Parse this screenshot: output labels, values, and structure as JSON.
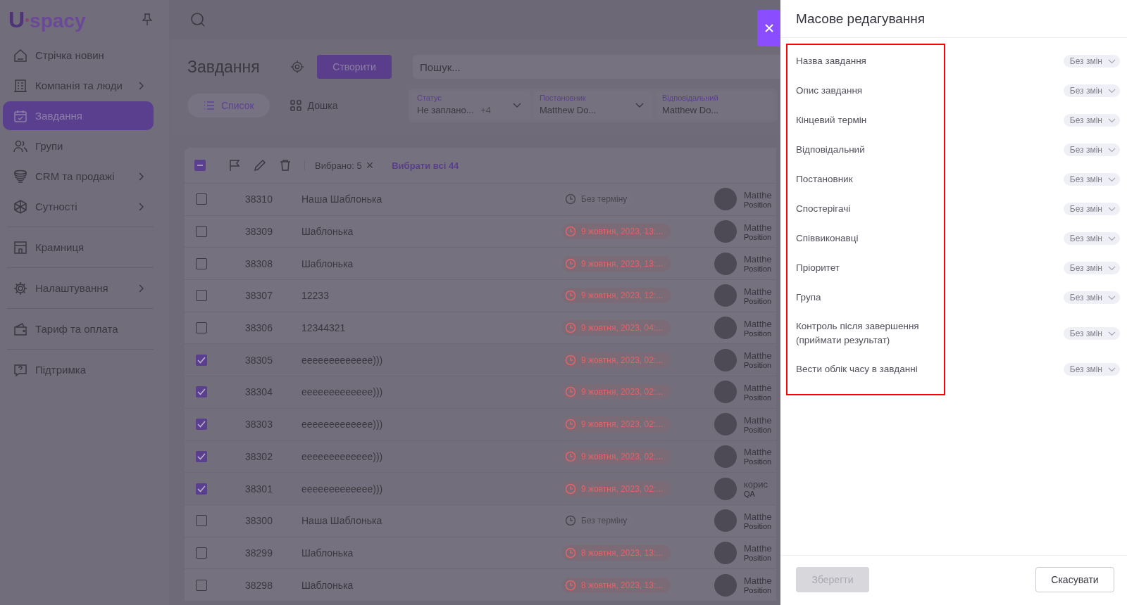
{
  "logo": {
    "mark": "U",
    "text": "spacy"
  },
  "sidebar": {
    "items": [
      {
        "label": "Стрічка новин",
        "chevron": false,
        "selected": false,
        "divider_after": false
      },
      {
        "label": "Компанія та люди",
        "chevron": true,
        "selected": false,
        "divider_after": false
      },
      {
        "label": "Завдання",
        "chevron": false,
        "selected": true,
        "divider_after": false
      },
      {
        "label": "Групи",
        "chevron": false,
        "selected": false,
        "divider_after": false
      },
      {
        "label": "CRM та продажі",
        "chevron": true,
        "selected": false,
        "divider_after": false
      },
      {
        "label": "Сутності",
        "chevron": true,
        "selected": false,
        "divider_after": true
      },
      {
        "label": "Крамниця",
        "chevron": false,
        "selected": false,
        "divider_after": true
      },
      {
        "label": "Налаштування",
        "chevron": true,
        "selected": false,
        "divider_after": true
      },
      {
        "label": "Тариф та оплата",
        "chevron": false,
        "selected": false,
        "divider_after": true
      },
      {
        "label": "Підтримка",
        "chevron": false,
        "selected": false,
        "divider_after": false
      }
    ]
  },
  "page": {
    "title": "Завдання",
    "create_button": "Створити",
    "search": {
      "placeholder": "Пошук..."
    }
  },
  "view_tabs": [
    {
      "label": "Список",
      "selected": true
    },
    {
      "label": "Дошка",
      "selected": false
    }
  ],
  "filters": [
    {
      "label": "Статус",
      "value": "Не заплано...",
      "extra": "+4"
    },
    {
      "label": "Постановник",
      "value": "Matthew Do..."
    },
    {
      "label": "Відповідальний",
      "value": "Matthew Do..."
    }
  ],
  "toolbar": {
    "partially_checked": true,
    "selected_count": "Вибрано: 5",
    "clear": "×",
    "select_all": "Вибрати всі 44"
  },
  "table": {
    "rows": [
      {
        "checked": false,
        "id": "38310",
        "name": "Наша Шаблонька",
        "deadline": "Без терміну",
        "overdue": false,
        "person": "Matthe",
        "position": "Position"
      },
      {
        "checked": false,
        "id": "38309",
        "name": "Шаблонька",
        "deadline": "9 жовтня, 2023, 13:...",
        "overdue": true,
        "person": "Matthe",
        "position": "Position"
      },
      {
        "checked": false,
        "id": "38308",
        "name": "Шаблонька",
        "deadline": "9 жовтня, 2023, 13:...",
        "overdue": true,
        "person": "Matthe",
        "position": "Position"
      },
      {
        "checked": false,
        "id": "38307",
        "name": "12233",
        "deadline": "9 жовтня, 2023, 12:...",
        "overdue": true,
        "person": "Matthe",
        "position": "Position"
      },
      {
        "checked": false,
        "id": "38306",
        "name": "12344321",
        "deadline": "9 жовтня, 2023, 04:...",
        "overdue": true,
        "person": "Matthe",
        "position": "Position"
      },
      {
        "checked": true,
        "id": "38305",
        "name": "eeeeeeeeeeeee)))",
        "deadline": "9 жовтня, 2023, 02:...",
        "overdue": true,
        "person": "Matthe",
        "position": "Position"
      },
      {
        "checked": true,
        "id": "38304",
        "name": "eeeeeeeeeeeee)))",
        "deadline": "9 жовтня, 2023, 02:...",
        "overdue": true,
        "person": "Matthe",
        "position": "Position"
      },
      {
        "checked": true,
        "id": "38303",
        "name": "eeeeeeeeeeeee)))",
        "deadline": "9 жовтня, 2023, 02:...",
        "overdue": true,
        "person": "Matthe",
        "position": "Position"
      },
      {
        "checked": true,
        "id": "38302",
        "name": "eeeeeeeeeeeee)))",
        "deadline": "9 жовтня, 2023, 02:...",
        "overdue": true,
        "person": "Matthe",
        "position": "Position"
      },
      {
        "checked": true,
        "id": "38301",
        "name": "eeeeeeeeeeeee)))",
        "deadline": "9 жовтня, 2023, 02:...",
        "overdue": true,
        "person": "корис",
        "position": "QA"
      },
      {
        "checked": false,
        "id": "38300",
        "name": "Наша Шаблонька",
        "deadline": "Без терміну",
        "overdue": false,
        "person": "Matthe",
        "position": "Position"
      },
      {
        "checked": false,
        "id": "38299",
        "name": "Шаблонька",
        "deadline": "8 жовтня, 2023, 13:...",
        "overdue": true,
        "person": "Matthe",
        "position": "Position"
      },
      {
        "checked": false,
        "id": "38298",
        "name": "Шаблонька",
        "deadline": "8 жовтня, 2023, 13:...",
        "overdue": true,
        "person": "Matthe",
        "position": "Position"
      }
    ]
  },
  "drawer": {
    "title": "Масове редагування",
    "fields": [
      {
        "label": "Назва завдання",
        "value": "Без змін"
      },
      {
        "label": "Опис завдання",
        "value": "Без змін"
      },
      {
        "label": "Кінцевий термін",
        "value": "Без змін"
      },
      {
        "label": "Відповідальний",
        "value": "Без змін"
      },
      {
        "label": "Постановник",
        "value": "Без змін"
      },
      {
        "label": "Спостерігачі",
        "value": "Без змін"
      },
      {
        "label": "Співвиконавці",
        "value": "Без змін"
      },
      {
        "label": "Пріоритет",
        "value": "Без змін"
      },
      {
        "label": "Група",
        "value": "Без змін"
      },
      {
        "label": "Контроль після завершення (приймати результат)",
        "value": "Без змін"
      },
      {
        "label": "Вести облік часу в завданні",
        "value": "Без змін"
      }
    ],
    "save_button": {
      "label": "Зберегти",
      "disabled": true
    },
    "cancel_button": "Скасувати"
  }
}
